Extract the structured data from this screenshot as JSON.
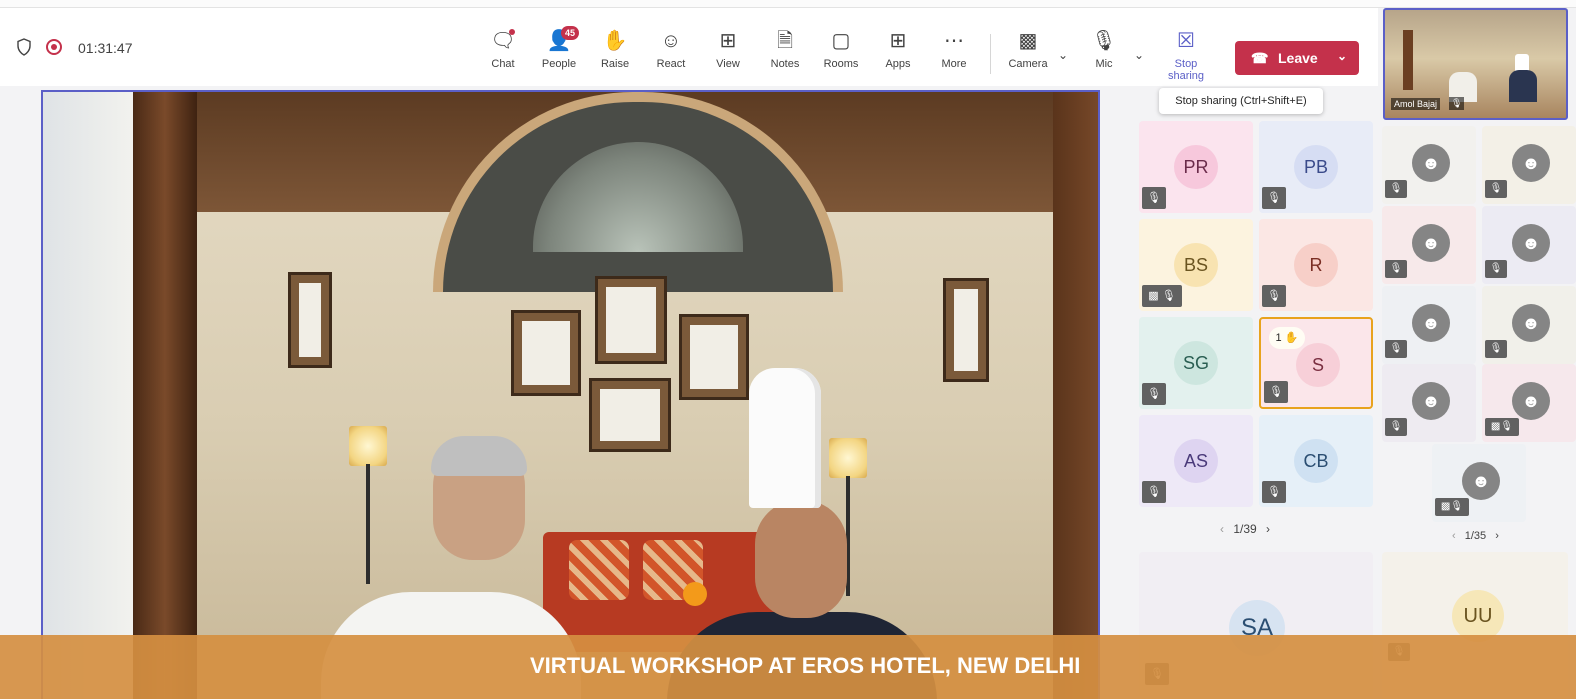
{
  "meeting": {
    "timer": "01:31:47"
  },
  "toolbar": {
    "chat": "Chat",
    "people": "People",
    "people_count": "45",
    "raise": "Raise",
    "react": "React",
    "view": "View",
    "notes": "Notes",
    "rooms": "Rooms",
    "apps": "Apps",
    "more": "More",
    "camera": "Camera",
    "mic": "Mic",
    "stop_sharing": "Stop sharing",
    "leave": "Leave",
    "tooltip": "Stop sharing (Ctrl+Shift+E)"
  },
  "self_view": {
    "name": "Amol Bajaj"
  },
  "participants": [
    {
      "initials": "PR",
      "color": "#fbe4ee",
      "avatar_bg": "#f7c8dc",
      "text": "#6a2b4a"
    },
    {
      "initials": "PB",
      "color": "#e8ecf7",
      "avatar_bg": "#d6ddf3",
      "text": "#3a4a8a"
    },
    {
      "initials": "BS",
      "color": "#fcf3df",
      "avatar_bg": "#f8e3b1",
      "text": "#6a5420"
    },
    {
      "initials": "R",
      "color": "#fbe7e4",
      "avatar_bg": "#f7cfc8",
      "text": "#7a2e24"
    },
    {
      "initials": "SG",
      "color": "#e3f1ee",
      "avatar_bg": "#cde6df",
      "text": "#2a5e52"
    },
    {
      "initials": "S",
      "color": "#fbe6ea",
      "avatar_bg": "#f7cfd8",
      "text": "#7a2e40",
      "hand": "1"
    },
    {
      "initials": "AS",
      "color": "#eee9f7",
      "avatar_bg": "#ded4f1",
      "text": "#4a3a7a"
    },
    {
      "initials": "CB",
      "color": "#e6f0f8",
      "avatar_bg": "#cfe1f2",
      "text": "#2b4e72"
    }
  ],
  "pager_left": "1/39",
  "pager_right": "1/35",
  "big_tiles": {
    "left": "SA",
    "right": "UU"
  },
  "banner": {
    "text": "VIRTUAL WORKSHOP AT EROS HOTEL, NEW DELHI"
  },
  "colors": {
    "accent": "#5b5fc7",
    "leave": "#c4314b",
    "banner": "#d58f41",
    "highlight": "#e8a31d"
  },
  "icons": {
    "shield": "shield-icon",
    "record": "record-icon",
    "chat": "chat-icon",
    "people": "people-icon",
    "raise": "raise-hand-icon",
    "react": "smile-icon",
    "view": "grid-icon",
    "notes": "notes-icon",
    "rooms": "rooms-icon",
    "apps": "plus-box-icon",
    "more": "ellipsis-icon",
    "camera": "camera-off-icon",
    "mic": "mic-off-icon",
    "share": "share-screen-icon",
    "leave": "phone-hangup-icon"
  }
}
